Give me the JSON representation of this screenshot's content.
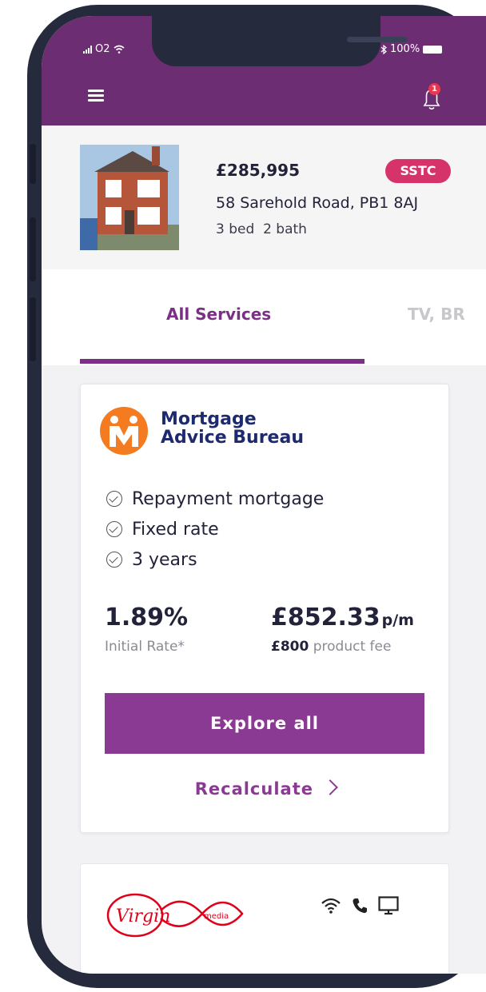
{
  "status_bar": {
    "carrier": "O2",
    "battery": "100%"
  },
  "notifications": {
    "count": "1"
  },
  "property": {
    "price": "£285,995",
    "status_badge": "SSTC",
    "address": "58 Sarehold Road, PB1 8AJ",
    "beds_baths": "3 bed  2 bath"
  },
  "tabs": [
    {
      "label": "All Services",
      "active": true
    },
    {
      "label": "TV, BR",
      "active": false
    }
  ],
  "mortgage_card": {
    "provider_line1": "Mortgage",
    "provider_line2": "Advice Bureau",
    "features": [
      "Repayment mortgage",
      "Fixed rate",
      "3 years"
    ],
    "rate": "1.89%",
    "rate_label": "Initial Rate*",
    "monthly": "£852.33",
    "monthly_suffix": "p/m",
    "fee_amount": "£800",
    "fee_label": "product fee",
    "explore_label": "Explore all",
    "recalculate_label": "Recalculate"
  },
  "broadband_card": {
    "logo_text": "Virgin",
    "logo_subtext": "media",
    "service_icons": [
      "wifi-icon",
      "phone-icon",
      "tv-icon"
    ]
  },
  "colors": {
    "brand_purple": "#6c2d73",
    "accent_purple": "#8b3a94",
    "badge_pink": "#d6336a",
    "notification_red": "#e8374f",
    "virgin_red": "#e1001a",
    "mab_orange": "#f47b20"
  }
}
